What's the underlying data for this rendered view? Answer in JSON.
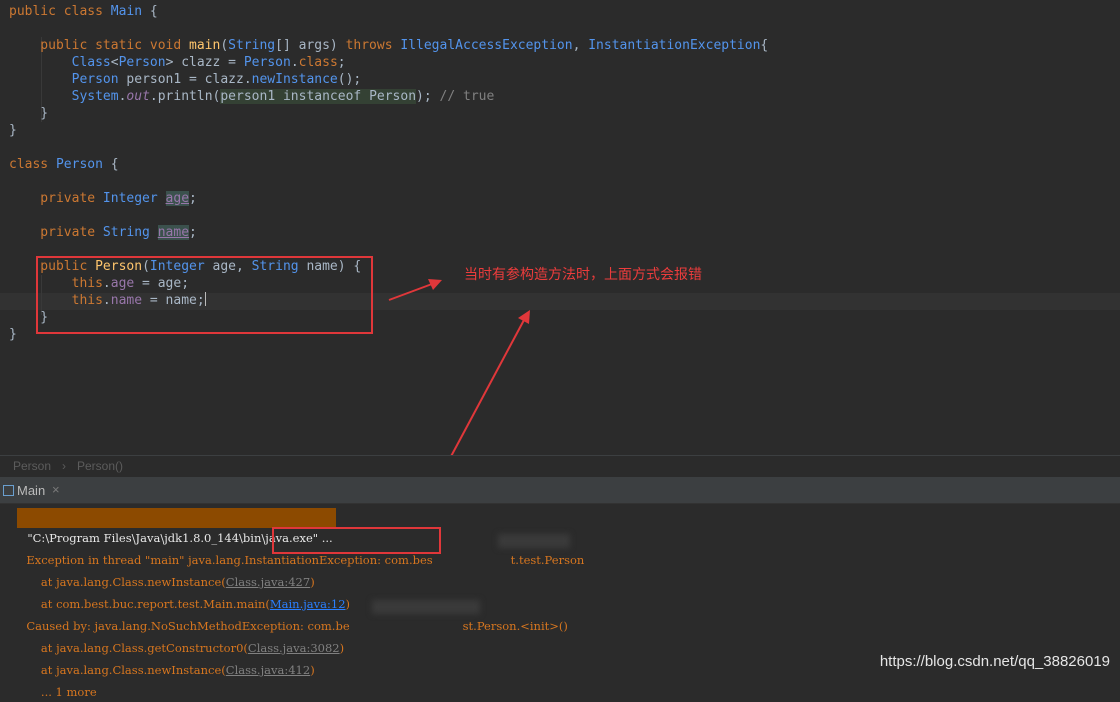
{
  "editor": {
    "lines": [
      [
        {
          "t": "public class ",
          "c": "k"
        },
        {
          "t": "Main",
          "c": "t"
        },
        {
          "t": " {",
          "c": ""
        }
      ],
      [],
      [
        {
          "t": "    public static void ",
          "c": "k"
        },
        {
          "t": "main",
          "c": "m"
        },
        {
          "t": "(",
          "c": ""
        },
        {
          "t": "String",
          "c": "t"
        },
        {
          "t": "[] args) ",
          "c": ""
        },
        {
          "t": "throws ",
          "c": "k"
        },
        {
          "t": "IllegalAccessException",
          "c": "t"
        },
        {
          "t": ", ",
          "c": ""
        },
        {
          "t": "InstantiationException",
          "c": "t"
        },
        {
          "t": "{",
          "c": ""
        }
      ],
      [
        {
          "t": "        ",
          "c": ""
        },
        {
          "t": "Class",
          "c": "t"
        },
        {
          "t": "<",
          "c": ""
        },
        {
          "t": "Person",
          "c": "t"
        },
        {
          "t": "> clazz = ",
          "c": ""
        },
        {
          "t": "Person",
          "c": "t"
        },
        {
          "t": ".",
          "c": ""
        },
        {
          "t": "class",
          "c": "k"
        },
        {
          "t": ";",
          "c": ""
        }
      ],
      [
        {
          "t": "        ",
          "c": ""
        },
        {
          "t": "Person",
          "c": "t"
        },
        {
          "t": " person1 = clazz.",
          "c": ""
        },
        {
          "t": "newInstance",
          "c": "t"
        },
        {
          "t": "();",
          "c": ""
        }
      ],
      [
        {
          "t": "        ",
          "c": ""
        },
        {
          "t": "System",
          "c": "t"
        },
        {
          "t": ".",
          "c": ""
        },
        {
          "t": "out",
          "c": "fi"
        },
        {
          "t": ".println(",
          "c": ""
        },
        {
          "t": "person1 instanceof Person",
          "c": "hlf"
        },
        {
          "t": "); ",
          "c": ""
        },
        {
          "t": "// true",
          "c": "c"
        }
      ],
      [
        {
          "t": "    }",
          "c": ""
        }
      ],
      [
        {
          "t": "}",
          "c": ""
        }
      ],
      [],
      [
        {
          "t": "class ",
          "c": "k"
        },
        {
          "t": "Person",
          "c": "t"
        },
        {
          "t": " {",
          "c": ""
        }
      ],
      [],
      [
        {
          "t": "    private ",
          "c": "k"
        },
        {
          "t": "Integer",
          "c": "t"
        },
        {
          "t": " ",
          "c": ""
        },
        {
          "t": "age",
          "c": "fhl"
        },
        {
          "t": ";",
          "c": ""
        }
      ],
      [],
      [
        {
          "t": "    private ",
          "c": "k"
        },
        {
          "t": "String",
          "c": "t"
        },
        {
          "t": " ",
          "c": ""
        },
        {
          "t": "name",
          "c": "fhl"
        },
        {
          "t": ";",
          "c": ""
        }
      ],
      [],
      [
        {
          "t": "    public ",
          "c": "k"
        },
        {
          "t": "Person",
          "c": "m"
        },
        {
          "t": "(",
          "c": ""
        },
        {
          "t": "Integer",
          "c": "t"
        },
        {
          "t": " age, ",
          "c": ""
        },
        {
          "t": "String",
          "c": "t"
        },
        {
          "t": " name) {",
          "c": ""
        }
      ],
      [
        {
          "t": "        this",
          "c": "k"
        },
        {
          "t": ".",
          "c": ""
        },
        {
          "t": "age",
          "c": "f"
        },
        {
          "t": " = age;",
          "c": ""
        }
      ],
      [
        {
          "t": "        this",
          "c": "k"
        },
        {
          "t": ".",
          "c": ""
        },
        {
          "t": "name",
          "c": "f"
        },
        {
          "t": " = name;",
          "c": ""
        },
        {
          "t": "",
          "c": "caret"
        }
      ],
      [
        {
          "t": "    }",
          "c": ""
        }
      ],
      [
        {
          "t": "}",
          "c": ""
        }
      ]
    ]
  },
  "annotation": {
    "text": "当时有参构造方法时，上面方式会报错"
  },
  "breadcrumb": {
    "item1": "Person",
    "separator": "›",
    "item2": "Person()"
  },
  "run_tab": {
    "label": "Main",
    "close": "×"
  },
  "console": {
    "cmd": "\"C:\\Program Files\\Java\\jdk1.8.0_144\\bin\\java.exe\" ...",
    "exc_prefix": "Exception in thread \"main\" java.lang.",
    "exc_name": "InstantiationException:",
    "exc_pkg": " com.bes",
    "exc_cls": "t.test.Person",
    "at1_pre": "    at java.lang.Class.newInstance(",
    "at1_link": "Class.java:427",
    "at1_post": ")",
    "at2_pre": "    at com.best.buc.report.test.Main.main(",
    "at2_link": "Main.java:12",
    "at2_post": ")",
    "caused_pre": "Caused by: java.lang.NoSuchMethodException: com.be",
    "caused_post": "st.Person.<init>()",
    "at3_pre": "    at java.lang.Class.getConstructor0(",
    "at3_link": "Class.java:3082",
    "at3_post": ")",
    "at4_pre": "    at java.lang.Class.newInstance(",
    "at4_link": "Class.java:412",
    "at4_post": ")",
    "more": "    ... 1 more"
  },
  "watermark": "https://blog.csdn.net/qq_38826019"
}
